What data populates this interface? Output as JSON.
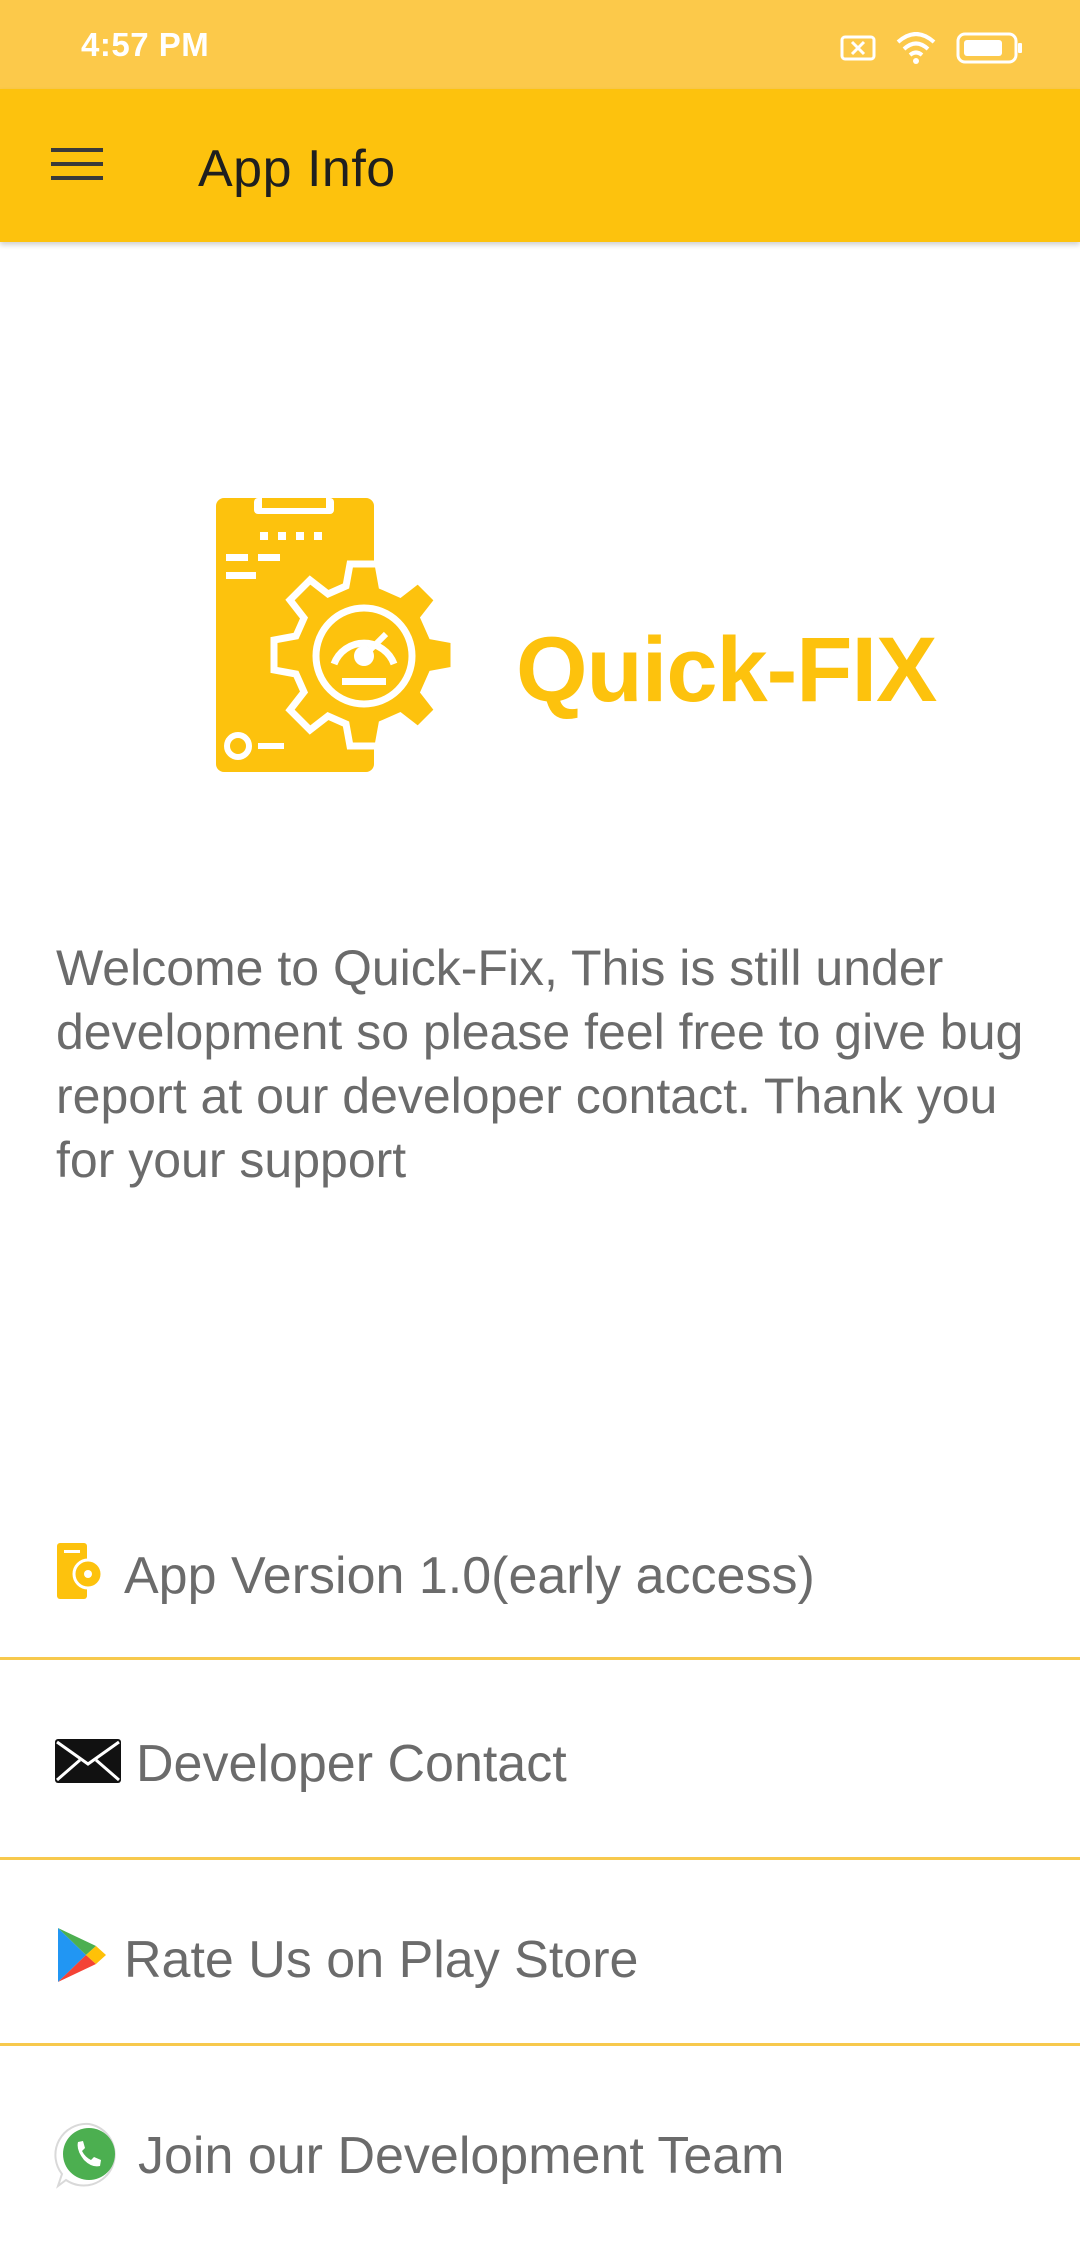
{
  "status_bar": {
    "time": "4:57 PM",
    "icons": [
      "sim-off-icon",
      "wifi-icon",
      "battery-icon"
    ]
  },
  "app_bar": {
    "title": "App Info",
    "menu_icon": "hamburger-menu-icon"
  },
  "logo": {
    "brand_name": "Quick-FIX",
    "icon": "phone-gear-logo-icon"
  },
  "welcome_text": "Welcome to Quick-Fix, This is still under development so please feel free to give bug report at our developer contact. Thank you for your support",
  "info_items": [
    {
      "label": "App Version 1.0(early access)",
      "icon": "app-logo-small-icon"
    },
    {
      "label": "Developer Contact",
      "icon": "envelope-icon"
    },
    {
      "label": "Rate Us on Play Store",
      "icon": "play-store-icon"
    },
    {
      "label": "Join our Development Team",
      "icon": "whatsapp-icon"
    }
  ],
  "colors": {
    "accent": "#FDC20D",
    "status_bar": "#FCC94A",
    "divider": "#F7C94D",
    "text_gray": "#6b6b6b"
  }
}
